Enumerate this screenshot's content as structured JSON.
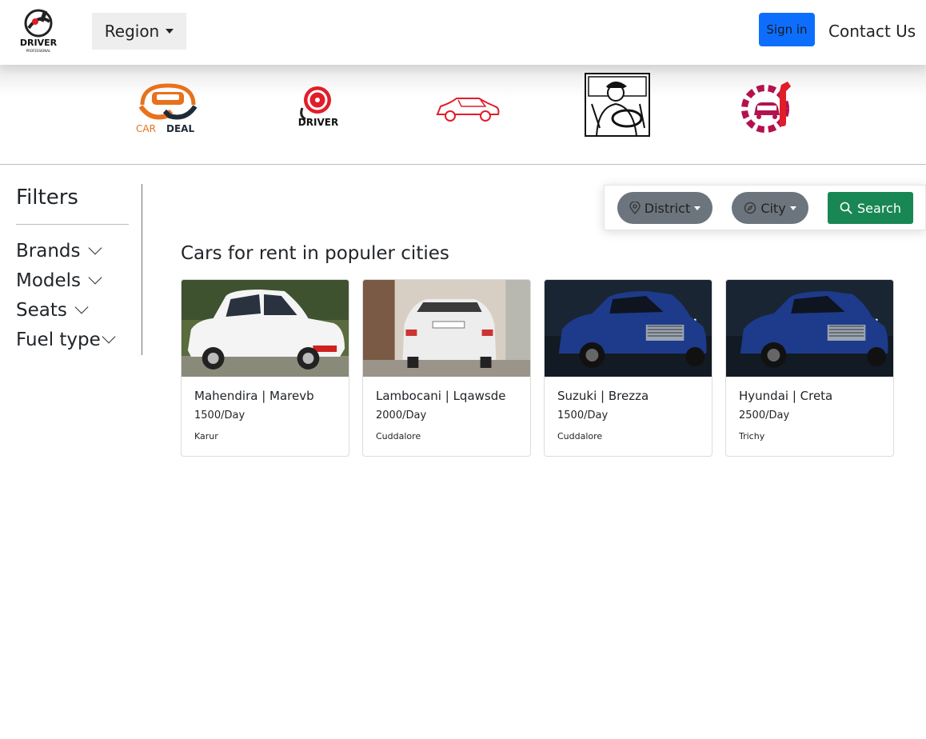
{
  "header": {
    "logo_text": "DRIVER",
    "logo_subtext": "PROFESSIONAL",
    "region_label": "Region",
    "signin_label": "Sign in",
    "contact_label": "Contact Us"
  },
  "banner": {
    "logos": [
      {
        "name": "car-deal-logo",
        "text": "CAR DEAL",
        "text_part1": "CAR ",
        "text_part2": "DEAL"
      },
      {
        "name": "driver-logo",
        "text": "DRIVER"
      },
      {
        "name": "car-outline-logo"
      },
      {
        "name": "driver-illustration-logo"
      },
      {
        "name": "car-service-logo"
      }
    ]
  },
  "sidebar": {
    "title": "Filters",
    "items": [
      {
        "label": "Brands"
      },
      {
        "label": "Models"
      },
      {
        "label": "Seats"
      },
      {
        "label": "Fuel type"
      }
    ]
  },
  "search": {
    "district_label": "District",
    "city_label": "City",
    "search_label": "Search"
  },
  "main": {
    "title": "Cars for rent in populer cities",
    "cards": [
      {
        "title": "Mahendira | Marevb",
        "price": "1500/Day",
        "location": "Karur"
      },
      {
        "title": "Lambocani | Lqawsde",
        "price": "2000/Day",
        "location": "Cuddalore"
      },
      {
        "title": "Suzuki | Brezza",
        "price": "1500/Day",
        "location": "Cuddalore"
      },
      {
        "title": "Hyundai | Creta",
        "price": "2500/Day",
        "location": "Trichy"
      }
    ]
  },
  "colors": {
    "primary": "#0d6efd",
    "secondary": "#6c757d",
    "success": "#198754",
    "brand_orange": "#e8711c",
    "brand_red": "#e11d2a",
    "brand_magenta": "#b3124f"
  }
}
